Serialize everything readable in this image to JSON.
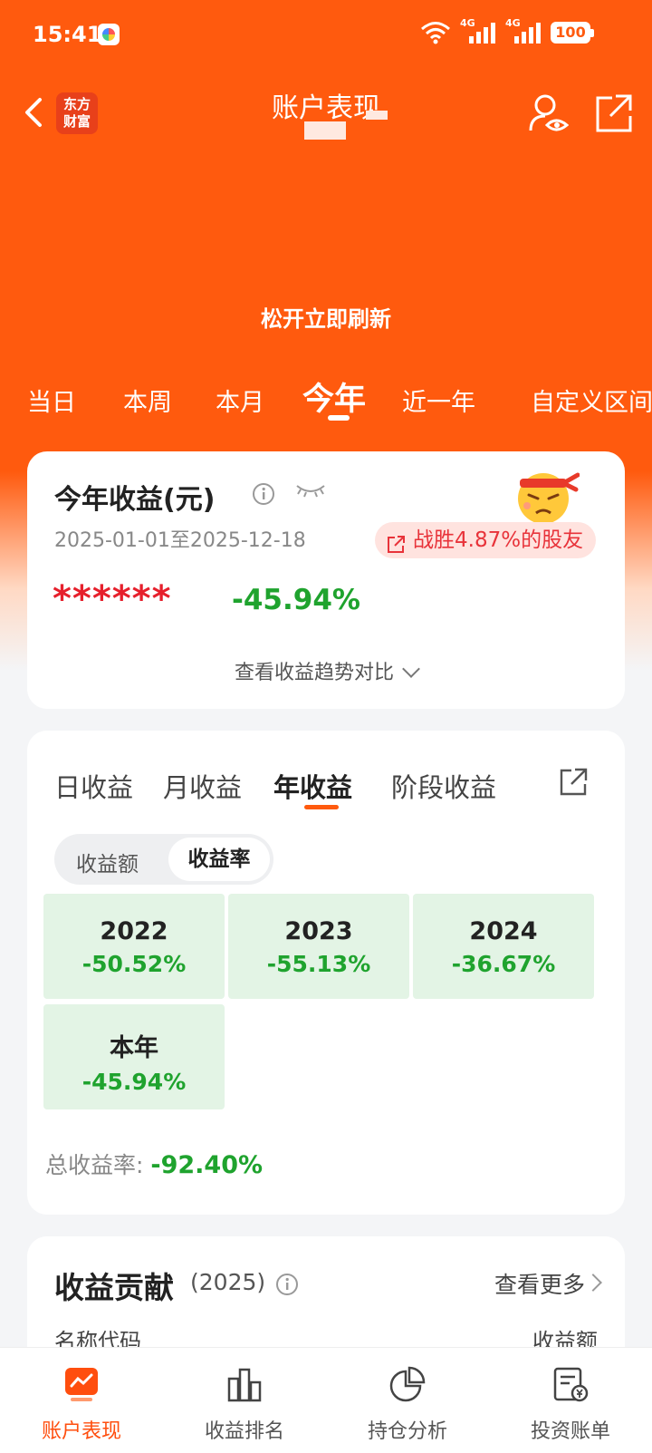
{
  "status_bar": {
    "time": "15:41",
    "signal1": "4G",
    "signal2": "4G",
    "battery": "100"
  },
  "nav": {
    "back_label": "返回",
    "logo_line1": "东方",
    "logo_line2": "财富",
    "title": "账户表现"
  },
  "refresh_hint": "松开立即刷新",
  "period_tabs": [
    "当日",
    "本周",
    "本月",
    "今年",
    "近一年",
    "自定义区间"
  ],
  "period_active": "今年",
  "summary": {
    "title": "今年收益(元)",
    "date_range": "2025-01-01至2025-12-18",
    "beat_text": "战胜4.87%的股友",
    "amount_masked": "******",
    "return_pct": "-45.94%",
    "trend_link": "查看收益趋势对比"
  },
  "returns": {
    "tabs": [
      "日收益",
      "月收益",
      "年收益",
      "阶段收益"
    ],
    "active_tab": "年收益",
    "segments": [
      "收益额",
      "收益率"
    ],
    "active_segment": "收益率",
    "years": [
      {
        "label": "2022",
        "value": "-50.52%"
      },
      {
        "label": "2023",
        "value": "-55.13%"
      },
      {
        "label": "2024",
        "value": "-36.67%"
      },
      {
        "label": "本年",
        "value": "-45.94%"
      }
    ],
    "total_label": "总收益率: ",
    "total_value": "-92.40%"
  },
  "contribution": {
    "title": "收益贡献",
    "year": "(2025)",
    "more": "查看更多",
    "col_name": "名称代码",
    "col_amount": "收益额"
  },
  "bottom_nav": [
    {
      "label": "账户表现",
      "icon": "chart-icon",
      "active": true
    },
    {
      "label": "收益排名",
      "icon": "bar-icon",
      "active": false
    },
    {
      "label": "持仓分析",
      "icon": "pie-icon",
      "active": false
    },
    {
      "label": "投资账单",
      "icon": "bill-icon",
      "active": false
    }
  ],
  "colors": {
    "brand": "#ff5a0e",
    "loss": "#1fa32e",
    "loss_bg": "#e3f4e5",
    "star": "#e6202c"
  }
}
